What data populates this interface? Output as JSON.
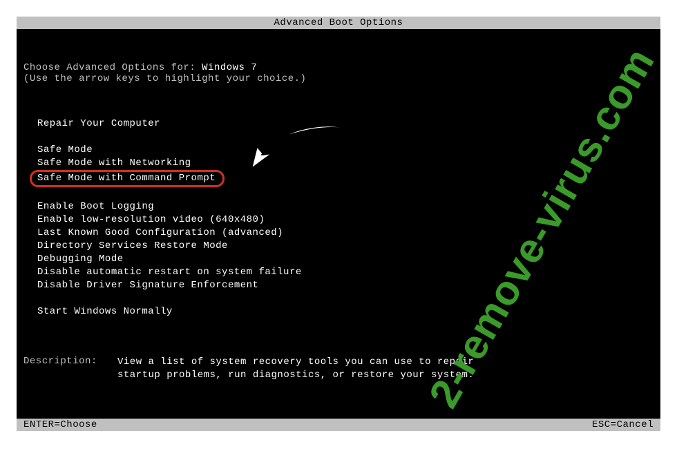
{
  "title": "Advanced Boot Options",
  "instruction_prefix": "Choose Advanced Options for: ",
  "os_name": "Windows 7",
  "instruction_hint": "(Use the arrow keys to highlight your choice.)",
  "menu": {
    "group0": {
      "items": [
        "Repair Your Computer"
      ]
    },
    "group1": {
      "items": [
        "Safe Mode",
        "Safe Mode with Networking",
        "Safe Mode with Command Prompt"
      ],
      "highlighted_index": 2
    },
    "group2": {
      "items": [
        "Enable Boot Logging",
        "Enable low-resolution video (640x480)",
        "Last Known Good Configuration (advanced)",
        "Directory Services Restore Mode",
        "Debugging Mode",
        "Disable automatic restart on system failure",
        "Disable Driver Signature Enforcement"
      ]
    },
    "group3": {
      "items": [
        "Start Windows Normally"
      ]
    }
  },
  "description": {
    "label": "Description:",
    "text": "View a list of system recovery tools you can use to repair startup problems, run diagnostics, or restore your system."
  },
  "footer": {
    "left": "ENTER=Choose",
    "right": "ESC=Cancel"
  },
  "watermark": "2-remove-virus.com"
}
